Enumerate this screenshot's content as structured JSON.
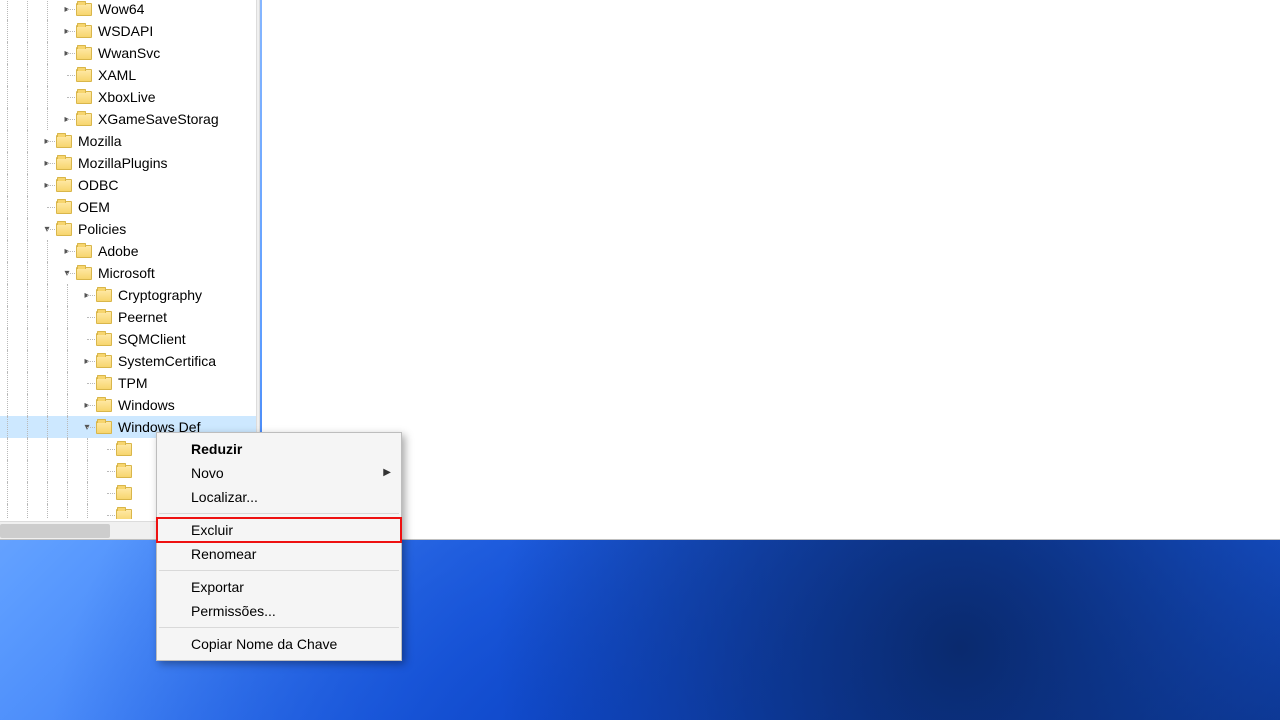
{
  "tree": [
    {
      "indent": 4,
      "tw": "right",
      "label": "Wow64"
    },
    {
      "indent": 4,
      "tw": "right",
      "label": "WSDAPI"
    },
    {
      "indent": 4,
      "tw": "right",
      "label": "WwanSvc"
    },
    {
      "indent": 4,
      "tw": "",
      "label": "XAML"
    },
    {
      "indent": 4,
      "tw": "",
      "label": "XboxLive"
    },
    {
      "indent": 4,
      "tw": "right",
      "label": "XGameSaveStorag"
    },
    {
      "indent": 3,
      "tw": "right",
      "label": "Mozilla"
    },
    {
      "indent": 3,
      "tw": "right",
      "label": "MozillaPlugins"
    },
    {
      "indent": 3,
      "tw": "right",
      "label": "ODBC"
    },
    {
      "indent": 3,
      "tw": "",
      "label": "OEM"
    },
    {
      "indent": 3,
      "tw": "down",
      "label": "Policies"
    },
    {
      "indent": 4,
      "tw": "right",
      "label": "Adobe"
    },
    {
      "indent": 4,
      "tw": "down",
      "label": "Microsoft"
    },
    {
      "indent": 5,
      "tw": "right",
      "label": "Cryptography"
    },
    {
      "indent": 5,
      "tw": "",
      "label": "Peernet"
    },
    {
      "indent": 5,
      "tw": "",
      "label": "SQMClient"
    },
    {
      "indent": 5,
      "tw": "right",
      "label": "SystemCertifica"
    },
    {
      "indent": 5,
      "tw": "",
      "label": "TPM"
    },
    {
      "indent": 5,
      "tw": "right",
      "label": "Windows"
    },
    {
      "indent": 5,
      "tw": "down",
      "label": "Windows Def",
      "selected": true
    },
    {
      "indent": 6,
      "tw": "",
      "label": ""
    },
    {
      "indent": 6,
      "tw": "",
      "label": ""
    },
    {
      "indent": 6,
      "tw": "",
      "label": ""
    },
    {
      "indent": 6,
      "tw": "",
      "label": ""
    }
  ],
  "contextMenu": {
    "reduce": "Reduzir",
    "new": "Novo",
    "find": "Localizar...",
    "delete": "Excluir",
    "rename": "Renomear",
    "export": "Exportar",
    "permissions": "Permissões...",
    "copyKey": "Copiar Nome da Chave"
  }
}
